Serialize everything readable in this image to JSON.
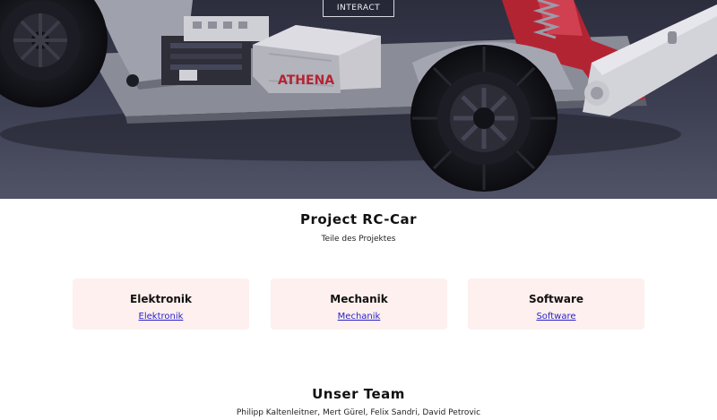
{
  "hero": {
    "interact_label": "INTERACT",
    "car_badge_text": "ATHENA"
  },
  "project": {
    "title": "Project RC-Car",
    "subtitle": "Teile des Projektes"
  },
  "cards": [
    {
      "title": "Elektronik",
      "link": "Elektronik"
    },
    {
      "title": "Mechanik",
      "link": "Mechanik"
    },
    {
      "title": "Software",
      "link": "Software"
    }
  ],
  "team": {
    "title": "Unser Team",
    "members": "Philipp Kaltenleitner, Mert Gürel, Felix Sandri, David Petrovic"
  },
  "colors": {
    "card_bg": "#fdf0ef",
    "link": "#2a20c8",
    "car_accent": "#b32433"
  }
}
